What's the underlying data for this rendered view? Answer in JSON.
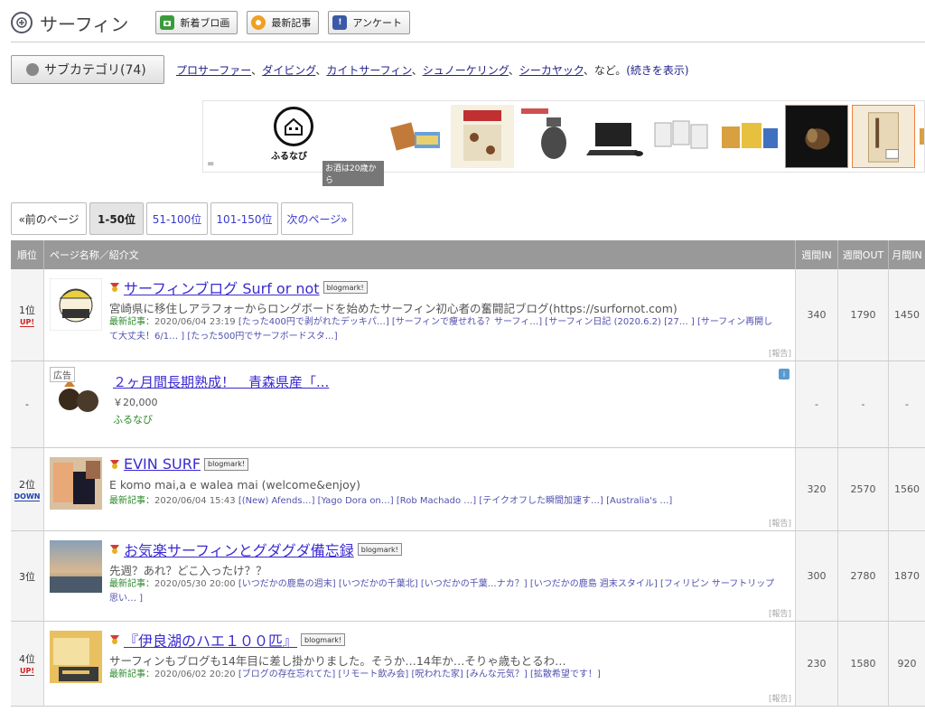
{
  "header": {
    "title": "サーフィン",
    "buttons": [
      {
        "label": "新着ブロ画"
      },
      {
        "label": "最新記事"
      },
      {
        "label": "アンケート"
      }
    ]
  },
  "subcategory": {
    "button_label": "サブカテゴリ(74)",
    "links": [
      "プロサーファー",
      "ダイビング",
      "カイトサーフィン",
      "シュノーケリング",
      "シーカヤック"
    ],
    "suffix": "、など。",
    "more": "(続きを表示)"
  },
  "ad_strip": {
    "brand": "ふるなび",
    "age_note": "お酒は20歳から",
    "eq": "="
  },
  "pager": {
    "prev": "«前のページ",
    "pages": [
      "1-50位",
      "51-100位",
      "101-150位"
    ],
    "next": "次のページ»"
  },
  "table": {
    "headers": {
      "rank": "順位",
      "name": "ページ名称／紹介文",
      "week_in": "週間IN",
      "week_out": "週間OUT",
      "month_in": "月間IN"
    },
    "latest_label": "最新記事：",
    "report_label": "[報告]",
    "badge_label": "blogmark!",
    "rows": [
      {
        "rank": "1位",
        "trend": "UP!",
        "title": "サーフィンブログ Surf or not",
        "desc": "宮崎県に移住しアラフォーからロングボードを始めたサーフィン初心者の奮闘記ブログ(https://surfornot.com)",
        "date": "2020/06/04 23:19",
        "articles": [
          "[たった400円で剥がれたデッキパ…]",
          "[サーフィンで痩せれる？サーフィ…]",
          "[サーフィン日記 (2020.6.2) [27… ]",
          "[サーフィン再開して大丈夫！6/1… ]",
          "[たった500円でサーフボードスタ…]"
        ],
        "week_in": "340",
        "week_out": "1790",
        "month_in": "1450"
      },
      {
        "rank": "2位",
        "trend": "DOWN",
        "title": "EVIN SURF",
        "desc": "E komo mai,a e walea mai (welcome&enjoy)",
        "date": "2020/06/04 15:43",
        "articles": [
          "[(New) Afends…]",
          "[Yago Dora on…]",
          "[Rob Machado …]",
          "[テイクオフした瞬間加速す…]",
          "[Australia's …]"
        ],
        "week_in": "320",
        "week_out": "2570",
        "month_in": "1560"
      },
      {
        "rank": "3位",
        "trend": "",
        "title": "お気楽サーフィンとグダグダ備忘録",
        "desc": "先週？あれ？どこ入ったけ？？",
        "date": "2020/05/30 20:00",
        "articles": [
          "[いつだかの鹿島の週末]",
          "[いつだかの千葉北]",
          "[いつだかの千葉…ナカ？]",
          "[いつだかの鹿島 週末スタイル]",
          "[フィリピン サーフトリップ思い… ]"
        ],
        "week_in": "300",
        "week_out": "2780",
        "month_in": "1870"
      },
      {
        "rank": "4位",
        "trend": "UP!",
        "title": "『伊良湖のハエ１００匹』",
        "desc": "サーフィンもブログも14年目に差し掛かりました。そうか…14年か…そりゃ歳もとるわ…",
        "date": "2020/06/02 20:20",
        "articles": [
          "[ブログの存在忘れてた]",
          "[リモート飲み会]",
          "[呪われた家]",
          "[みんな元気？]",
          "[拡散希望です！]"
        ],
        "week_in": "230",
        "week_out": "1580",
        "month_in": "920"
      }
    ],
    "ad_row": {
      "rank": "-",
      "ad_label": "広告",
      "title": "２ヶ月間長期熟成！　青森県産「...",
      "price": "￥20,000",
      "source": "ふるなび",
      "dash": "-"
    }
  },
  "colors": {
    "accent_link": "#3a2ad0",
    "header_gray": "#999999",
    "up_red": "#d02020",
    "down_blue": "#2040b0"
  }
}
